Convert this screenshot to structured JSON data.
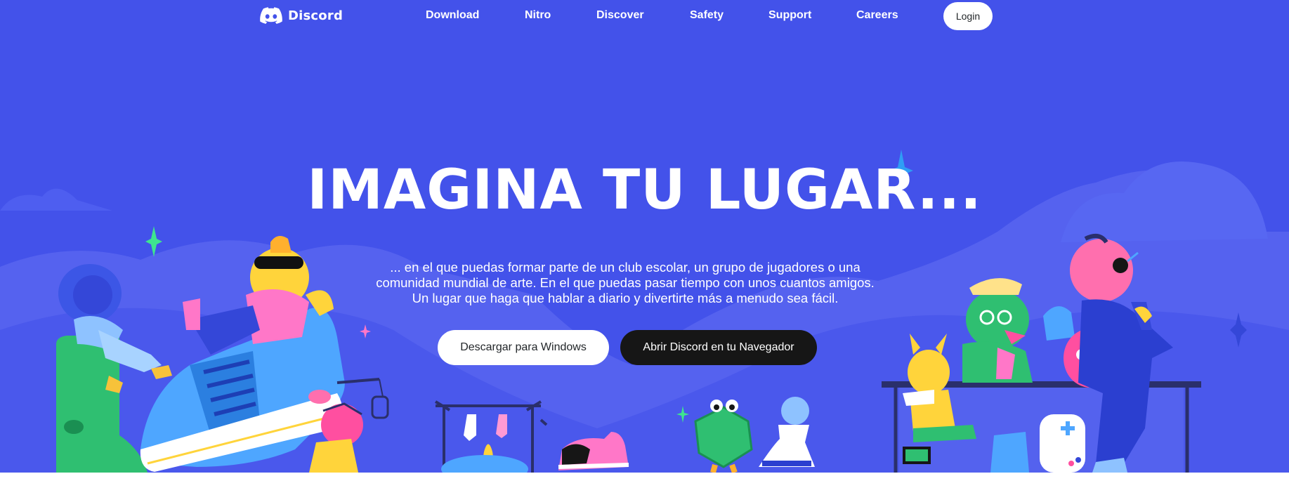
{
  "nav": {
    "logo_text": "Discord",
    "links": [
      "Download",
      "Nitro",
      "Discover",
      "Safety",
      "Support",
      "Careers"
    ],
    "login_label": "Login"
  },
  "hero": {
    "headline": "IMAGINA TU LUGAR...",
    "subtitle_lines": [
      "... en el que puedas formar parte de un club escolar, un grupo de jugadores o una",
      "comunidad mundial de arte. En el que puedas pasar tiempo con unos cuantos amigos.",
      "Un lugar que haga que hablar a diario y divertirte más a menudo sea fácil."
    ],
    "download_button": "Descargar para Windows",
    "browser_button": "Abrir Discord en tu Navegador"
  },
  "colors": {
    "background": "#4352ea",
    "button_light": "#ffffff",
    "button_dark": "#161616"
  },
  "icons": [
    "discord-logo-icon"
  ]
}
